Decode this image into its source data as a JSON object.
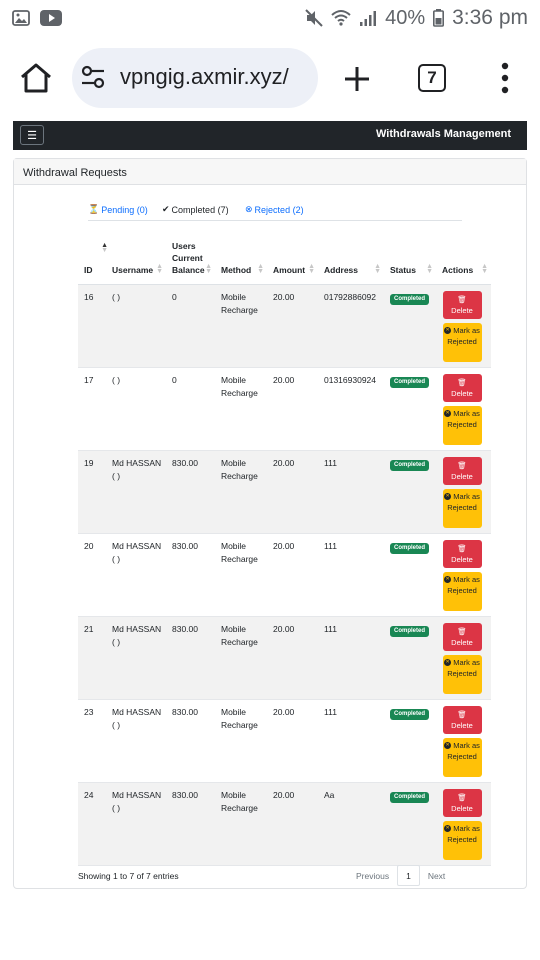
{
  "status_bar": {
    "battery": "40%",
    "time": "3:36 pm"
  },
  "browser": {
    "url": "vpngig.axmir.xyz/",
    "tab_count": "7"
  },
  "site": {
    "menu_toggle": "☰",
    "title": "Withdrawals Management"
  },
  "card": {
    "header": "Withdrawal Requests"
  },
  "tabs": [
    {
      "label": "Pending (0)"
    },
    {
      "label": "Completed (7)"
    },
    {
      "label": "Rejected (2)"
    }
  ],
  "table": {
    "columns": {
      "id": "ID",
      "username": "Username",
      "balance": "Users Current Balance",
      "method": "Method",
      "amount": "Amount",
      "address": "Address",
      "status": "Status",
      "actions": "Actions"
    },
    "delete_label": "Delete",
    "reject_label": "Mark as Rejected",
    "rows": [
      {
        "id": "16",
        "username": "( )",
        "balance": "0",
        "method": "Mobile Recharge",
        "amount": "20.00",
        "address": "01792886092",
        "status": "Completed"
      },
      {
        "id": "17",
        "username": "( )",
        "balance": "0",
        "method": "Mobile Recharge",
        "amount": "20.00",
        "address": "01316930924",
        "status": "Completed"
      },
      {
        "id": "19",
        "username": "Md HASSAN ( )",
        "balance": "830.00",
        "method": "Mobile Recharge",
        "amount": "20.00",
        "address": "111",
        "status": "Completed"
      },
      {
        "id": "20",
        "username": "Md HASSAN ( )",
        "balance": "830.00",
        "method": "Mobile Recharge",
        "amount": "20.00",
        "address": "111",
        "status": "Completed"
      },
      {
        "id": "21",
        "username": "Md HASSAN ( )",
        "balance": "830.00",
        "method": "Mobile Recharge",
        "amount": "20.00",
        "address": "111",
        "status": "Completed"
      },
      {
        "id": "23",
        "username": "Md HASSAN ( )",
        "balance": "830.00",
        "method": "Mobile Recharge",
        "amount": "20.00",
        "address": "111",
        "status": "Completed"
      },
      {
        "id": "24",
        "username": "Md HASSAN ( )",
        "balance": "830.00",
        "method": "Mobile Recharge",
        "amount": "20.00",
        "address": "Aa",
        "status": "Completed"
      }
    ],
    "info": "Showing 1 to 7 of 7 entries"
  },
  "pagination": {
    "previous": "Previous",
    "current": "1",
    "next": "Next"
  },
  "colors": {
    "accent": "#0d6efd",
    "danger": "#dc3545",
    "warning": "#ffc107",
    "success": "#198754",
    "navbar": "#212529"
  }
}
